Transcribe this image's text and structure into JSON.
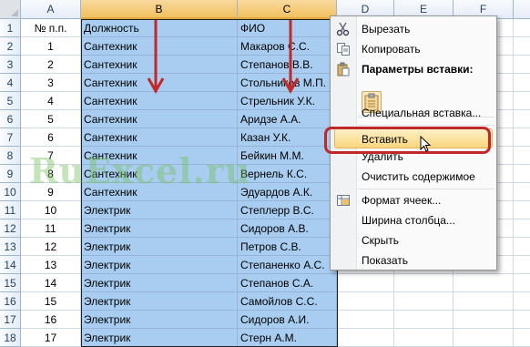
{
  "columns": {
    "a": "A",
    "b": "B",
    "c": "C",
    "d": "D",
    "e": "E",
    "f": "F"
  },
  "rows": [
    {
      "n": "1",
      "a": "№ п.п.",
      "b": "Должность",
      "c": "ФИО"
    },
    {
      "n": "2",
      "a": "1",
      "b": "Сантехник",
      "c": "Макаров С.С."
    },
    {
      "n": "3",
      "a": "2",
      "b": "Сантехник",
      "c": "Степанов В.В."
    },
    {
      "n": "4",
      "a": "3",
      "b": "Сантехник",
      "c": "Стольников М.П."
    },
    {
      "n": "5",
      "a": "4",
      "b": "Сантехник",
      "c": "Стрельник У.К."
    },
    {
      "n": "6",
      "a": "5",
      "b": "Сантехник",
      "c": "Аридзе А.А."
    },
    {
      "n": "7",
      "a": "6",
      "b": "Сантехник",
      "c": "Казан У.К."
    },
    {
      "n": "8",
      "a": "7",
      "b": "Сантехник",
      "c": "Бейкин М.М."
    },
    {
      "n": "9",
      "a": "8",
      "b": "Сантехник",
      "c": "Вернель К.С."
    },
    {
      "n": "10",
      "a": "9",
      "b": "Сантехник",
      "c": "Эдуардов А.К."
    },
    {
      "n": "11",
      "a": "10",
      "b": "Электрик",
      "c": "Степлерр В.С."
    },
    {
      "n": "12",
      "a": "11",
      "b": "Электрик",
      "c": "Сидоров А.В."
    },
    {
      "n": "13",
      "a": "12",
      "b": "Электрик",
      "c": "Петров С.В."
    },
    {
      "n": "14",
      "a": "13",
      "b": "Электрик",
      "c": "Степаненко А.С."
    },
    {
      "n": "15",
      "a": "14",
      "b": "Электрик",
      "c": "Степанов С.А."
    },
    {
      "n": "16",
      "a": "15",
      "b": "Электрик",
      "c": "Самойлов С.С."
    },
    {
      "n": "17",
      "a": "16",
      "b": "Электрик",
      "c": "Сидоров А.И."
    },
    {
      "n": "18",
      "a": "17",
      "b": "Электрик",
      "c": "Стерн А.М."
    }
  ],
  "watermark": "RuExcel.ru",
  "menu": {
    "cut": "Вырезать",
    "copy": "Копировать",
    "paste_options": "Параметры вставки:",
    "paste_special": "Специальная вставка...",
    "insert": "Вставить",
    "delete": "Удалить",
    "clear": "Очистить содержимое",
    "format": "Формат ячеек...",
    "col_width": "Ширина столбца...",
    "hide": "Скрыть",
    "show": "Показать"
  },
  "colors": {
    "selection": "#a8cdf0",
    "annotation": "#c0282a",
    "header_selected": "#f1c15f"
  },
  "icons": [
    "scissors-icon",
    "copy-icon",
    "paste-icon",
    "paste-option-icon",
    "format-cells-icon",
    "cursor-icon"
  ]
}
